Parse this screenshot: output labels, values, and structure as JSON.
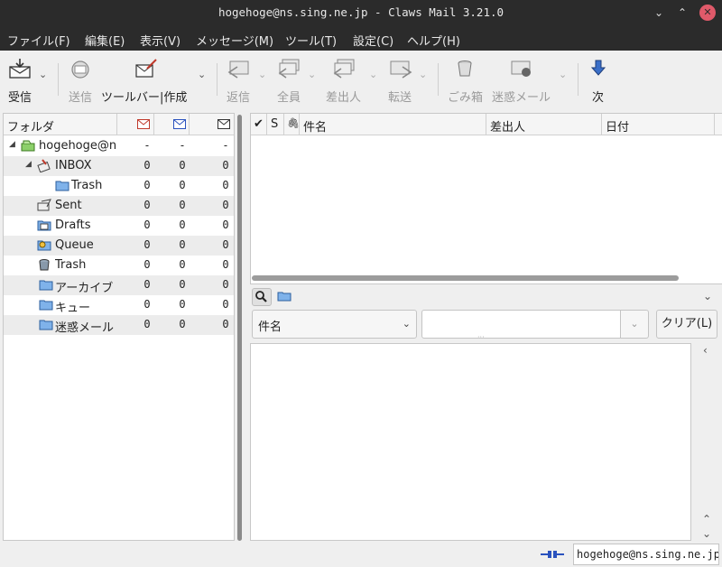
{
  "window": {
    "title": "hogehoge@ns.sing.ne.jp - Claws Mail 3.21.0",
    "controls": [
      "minimize-icon",
      "maximize-icon",
      "close-icon"
    ]
  },
  "menubar": {
    "items": [
      "ファイル(F)",
      "編集(E)",
      "表示(V)",
      "メッセージ(M)",
      "ツール(T)",
      "設定(C)",
      "ヘルプ(H)"
    ]
  },
  "toolbar": {
    "receive": "受信",
    "send": "送信",
    "toolbar_compose": "ツールバー|作成",
    "reply": "返信",
    "reply_all": "全員",
    "reply_sender": "差出人",
    "forward": "転送",
    "trash": "ごみ箱",
    "spam": "迷惑メール",
    "next": "次"
  },
  "folder_pane": {
    "header_label": "フォルダ",
    "header_icons": [
      "new-mail-icon",
      "unread-mail-icon",
      "total-mail-icon"
    ],
    "rows": [
      {
        "name": "hogehoge@ns.sing.ne.jp",
        "icon": "mailbox-icon",
        "new": "-",
        "unread": "-",
        "total": "-"
      },
      {
        "name": "INBOX",
        "icon": "inbox-icon",
        "new": "0",
        "unread": "0",
        "total": "0"
      },
      {
        "name": "Trash",
        "icon": "folder-icon",
        "new": "0",
        "unread": "0",
        "total": "0"
      },
      {
        "name": "Sent",
        "icon": "sent-icon",
        "new": "0",
        "unread": "0",
        "total": "0"
      },
      {
        "name": "Drafts",
        "icon": "drafts-icon",
        "new": "0",
        "unread": "0",
        "total": "0"
      },
      {
        "name": "Queue",
        "icon": "queue-icon",
        "new": "0",
        "unread": "0",
        "total": "0"
      },
      {
        "name": "Trash",
        "icon": "trash-icon",
        "new": "0",
        "unread": "0",
        "total": "0"
      },
      {
        "name": "アーカイブ",
        "icon": "folder-icon",
        "new": "0",
        "unread": "0",
        "total": "0"
      },
      {
        "name": "キュー",
        "icon": "folder-icon",
        "new": "0",
        "unread": "0",
        "total": "0"
      },
      {
        "name": "迷惑メール",
        "icon": "folder-icon",
        "new": "0",
        "unread": "0",
        "total": "0"
      }
    ]
  },
  "message_list": {
    "columns": [
      "✔",
      "S",
      "🖇",
      "件名",
      "差出人",
      "日付"
    ]
  },
  "quick_search": {
    "field_selected": "件名",
    "query": "",
    "clear_label": "クリア(L)"
  },
  "statusbar": {
    "account": "hogehoge@ns.sing.ne.jp"
  },
  "colors": {
    "titlebar_bg": "#2b2b2b",
    "window_bg": "#efefef",
    "close_button": "#e05a6a",
    "folder_blue": "#4a8fd8"
  }
}
